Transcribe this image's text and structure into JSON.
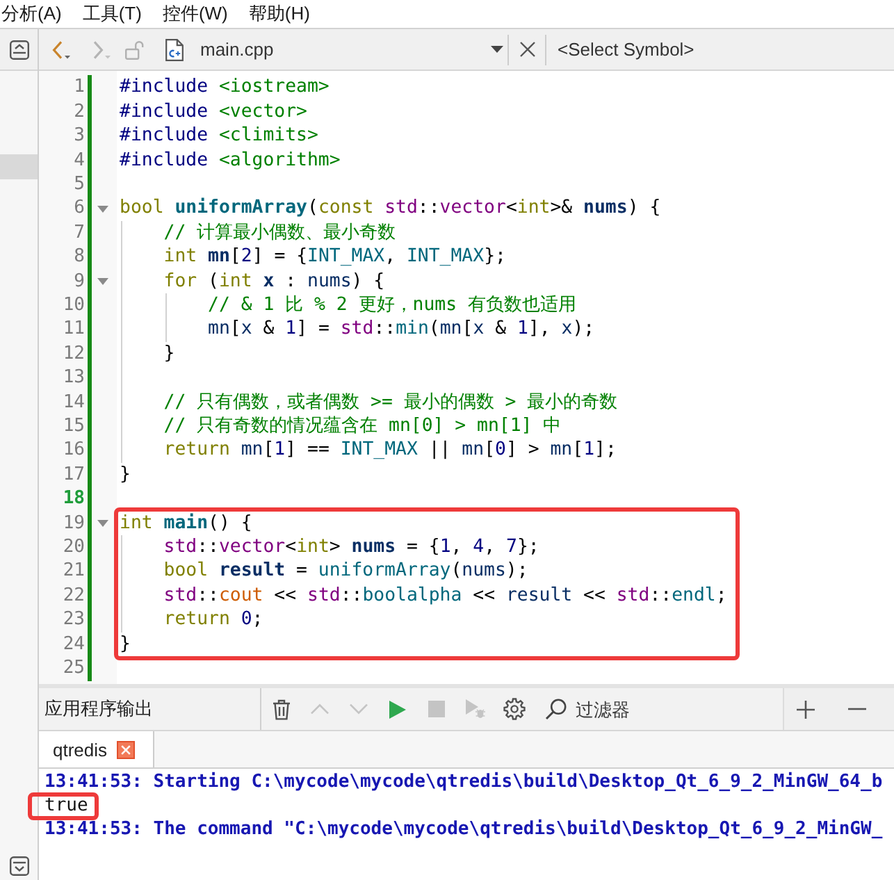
{
  "menu_bar": {
    "items": [
      {
        "label": "分析(A)"
      },
      {
        "label": "工具(T)"
      },
      {
        "label": "控件(W)"
      },
      {
        "label": "帮助(H)"
      }
    ]
  },
  "toolbar": {
    "navigation": [
      {
        "kind": "back",
        "disabled": false
      },
      {
        "kind": "forward",
        "disabled": true
      }
    ],
    "lock": {
      "locked": false
    },
    "file": {
      "name": "main.cpp"
    },
    "symbol": {
      "text": "<Select Symbol>"
    }
  },
  "sidebar": {
    "rows": [
      {
        "selected": false
      },
      {
        "selected": false
      },
      {
        "selected": false
      },
      {
        "selected": true
      }
    ]
  },
  "editor": {
    "modified": true,
    "lines": [
      {
        "number": "1",
        "current": false,
        "foldable": false,
        "boxed": false,
        "tokens": [
          {
            "kind": "preproc",
            "text": "#include"
          },
          {
            "kind": "header",
            "text": " <iostream>"
          }
        ]
      },
      {
        "number": "2",
        "current": false,
        "foldable": false,
        "boxed": false,
        "tokens": [
          {
            "kind": "preproc",
            "text": "#include"
          },
          {
            "kind": "header",
            "text": " <vector>"
          }
        ]
      },
      {
        "number": "3",
        "current": false,
        "foldable": false,
        "boxed": false,
        "tokens": [
          {
            "kind": "preproc",
            "text": "#include"
          },
          {
            "kind": "header",
            "text": " <climits>"
          }
        ]
      },
      {
        "number": "4",
        "current": false,
        "foldable": false,
        "boxed": false,
        "tokens": [
          {
            "kind": "preproc",
            "text": "#include"
          },
          {
            "kind": "header",
            "text": " <algorithm>"
          }
        ]
      },
      {
        "number": "5",
        "current": false,
        "foldable": false,
        "boxed": false
      },
      {
        "number": "6",
        "current": false,
        "foldable": true,
        "boxed": false,
        "tokens": [
          {
            "kind": "keyword",
            "text": "bool"
          },
          {
            "kind": "funcdecl",
            "text": " uniformArray"
          },
          {
            "kind": "punct",
            "text": "("
          },
          {
            "kind": "keyword",
            "text": "const"
          },
          {
            "kind": "namespace",
            "text": " std"
          },
          {
            "kind": "punct",
            "text": "::"
          },
          {
            "kind": "type",
            "text": "vector"
          },
          {
            "kind": "punct",
            "text": "<"
          },
          {
            "kind": "keyword",
            "text": "int"
          },
          {
            "kind": "punct",
            "text": ">& "
          },
          {
            "kind": "decl",
            "text": "nums"
          },
          {
            "kind": "punct",
            "text": ") {"
          }
        ]
      },
      {
        "number": "7",
        "current": false,
        "foldable": false,
        "boxed": false,
        "tokens": [
          {
            "kind": "comment",
            "text": "    // 计算最小偶数、最小奇数"
          }
        ]
      },
      {
        "number": "8",
        "current": false,
        "foldable": false,
        "boxed": false,
        "tokens": [
          {
            "kind": "keyword",
            "text": "    int"
          },
          {
            "kind": "decl",
            "text": " mn"
          },
          {
            "kind": "punct",
            "text": "["
          },
          {
            "kind": "number",
            "text": "2"
          },
          {
            "kind": "punct",
            "text": "] = {"
          },
          {
            "kind": "macro",
            "text": "INT_MAX"
          },
          {
            "kind": "punct",
            "text": ", "
          },
          {
            "kind": "macro",
            "text": "INT_MAX"
          },
          {
            "kind": "punct",
            "text": "};"
          }
        ]
      },
      {
        "number": "9",
        "current": false,
        "foldable": true,
        "boxed": false,
        "tokens": [
          {
            "kind": "keyword",
            "text": "    for"
          },
          {
            "kind": "punct",
            "text": " ("
          },
          {
            "kind": "keyword",
            "text": "int"
          },
          {
            "kind": "decl",
            "text": " x"
          },
          {
            "kind": "punct",
            "text": " : "
          },
          {
            "kind": "var",
            "text": "nums"
          },
          {
            "kind": "punct",
            "text": ") {"
          }
        ]
      },
      {
        "number": "10",
        "current": false,
        "foldable": false,
        "boxed": false,
        "tokens": [
          {
            "kind": "comment",
            "text": "        // & 1 比 % 2 更好，nums 有负数也适用"
          }
        ]
      },
      {
        "number": "11",
        "current": false,
        "foldable": false,
        "boxed": false,
        "tokens": [
          {
            "kind": "var",
            "text": "        mn"
          },
          {
            "kind": "punct",
            "text": "["
          },
          {
            "kind": "var",
            "text": "x"
          },
          {
            "kind": "punct",
            "text": " & "
          },
          {
            "kind": "number",
            "text": "1"
          },
          {
            "kind": "punct",
            "text": "] = "
          },
          {
            "kind": "namespace",
            "text": "std"
          },
          {
            "kind": "punct",
            "text": "::"
          },
          {
            "kind": "func",
            "text": "min"
          },
          {
            "kind": "punct",
            "text": "("
          },
          {
            "kind": "var",
            "text": "mn"
          },
          {
            "kind": "punct",
            "text": "["
          },
          {
            "kind": "var",
            "text": "x"
          },
          {
            "kind": "punct",
            "text": " & "
          },
          {
            "kind": "number",
            "text": "1"
          },
          {
            "kind": "punct",
            "text": "], "
          },
          {
            "kind": "var",
            "text": "x"
          },
          {
            "kind": "punct",
            "text": ");"
          }
        ]
      },
      {
        "number": "12",
        "current": false,
        "foldable": false,
        "boxed": false,
        "tokens": [
          {
            "kind": "punct",
            "text": "    }"
          }
        ]
      },
      {
        "number": "13",
        "current": false,
        "foldable": false,
        "boxed": false
      },
      {
        "number": "14",
        "current": false,
        "foldable": false,
        "boxed": false,
        "tokens": [
          {
            "kind": "comment",
            "text": "    // 只有偶数，或者偶数 >= 最小的偶数 > 最小的奇数"
          }
        ]
      },
      {
        "number": "15",
        "current": false,
        "foldable": false,
        "boxed": false,
        "tokens": [
          {
            "kind": "comment",
            "text": "    // 只有奇数的情况蕴含在 mn[0] > mn[1] 中"
          }
        ]
      },
      {
        "number": "16",
        "current": false,
        "foldable": false,
        "boxed": false,
        "tokens": [
          {
            "kind": "keyword",
            "text": "    return"
          },
          {
            "kind": "var",
            "text": " mn"
          },
          {
            "kind": "punct",
            "text": "["
          },
          {
            "kind": "number",
            "text": "1"
          },
          {
            "kind": "punct",
            "text": "] == "
          },
          {
            "kind": "macro",
            "text": "INT_MAX"
          },
          {
            "kind": "punct",
            "text": " || "
          },
          {
            "kind": "var",
            "text": "mn"
          },
          {
            "kind": "punct",
            "text": "["
          },
          {
            "kind": "number",
            "text": "0"
          },
          {
            "kind": "punct",
            "text": "] > "
          },
          {
            "kind": "var",
            "text": "mn"
          },
          {
            "kind": "punct",
            "text": "["
          },
          {
            "kind": "number",
            "text": "1"
          },
          {
            "kind": "punct",
            "text": "];"
          }
        ]
      },
      {
        "number": "17",
        "current": false,
        "foldable": false,
        "boxed": false,
        "tokens": [
          {
            "kind": "punct",
            "text": "}"
          }
        ]
      },
      {
        "number": "18",
        "current": true,
        "foldable": false,
        "boxed": false
      },
      {
        "number": "19",
        "current": false,
        "foldable": true,
        "boxed": true,
        "tokens": [
          {
            "kind": "keyword",
            "text": "int"
          },
          {
            "kind": "funcdecl",
            "text": " main"
          },
          {
            "kind": "punct",
            "text": "() {"
          }
        ]
      },
      {
        "number": "20",
        "current": false,
        "foldable": false,
        "boxed": true,
        "tokens": [
          {
            "kind": "namespace",
            "text": "    std"
          },
          {
            "kind": "punct",
            "text": "::"
          },
          {
            "kind": "type",
            "text": "vector"
          },
          {
            "kind": "punct",
            "text": "<"
          },
          {
            "kind": "keyword",
            "text": "int"
          },
          {
            "kind": "punct",
            "text": "> "
          },
          {
            "kind": "decl",
            "text": "nums"
          },
          {
            "kind": "punct",
            "text": " = {"
          },
          {
            "kind": "number",
            "text": "1"
          },
          {
            "kind": "punct",
            "text": ", "
          },
          {
            "kind": "number",
            "text": "4"
          },
          {
            "kind": "punct",
            "text": ", "
          },
          {
            "kind": "number",
            "text": "7"
          },
          {
            "kind": "punct",
            "text": "};"
          }
        ]
      },
      {
        "number": "21",
        "current": false,
        "foldable": false,
        "boxed": true,
        "tokens": [
          {
            "kind": "keyword",
            "text": "    bool"
          },
          {
            "kind": "decl",
            "text": " result"
          },
          {
            "kind": "punct",
            "text": " = "
          },
          {
            "kind": "func",
            "text": "uniformArray"
          },
          {
            "kind": "punct",
            "text": "("
          },
          {
            "kind": "var",
            "text": "nums"
          },
          {
            "kind": "punct",
            "text": ");"
          }
        ]
      },
      {
        "number": "22",
        "current": false,
        "foldable": false,
        "boxed": true,
        "tokens": [
          {
            "kind": "namespace",
            "text": "    std"
          },
          {
            "kind": "punct",
            "text": "::"
          },
          {
            "kind": "global",
            "text": "cout"
          },
          {
            "kind": "punct",
            "text": " << "
          },
          {
            "kind": "namespace",
            "text": "std"
          },
          {
            "kind": "punct",
            "text": "::"
          },
          {
            "kind": "func",
            "text": "boolalpha"
          },
          {
            "kind": "punct",
            "text": " << "
          },
          {
            "kind": "var",
            "text": "result"
          },
          {
            "kind": "punct",
            "text": " << "
          },
          {
            "kind": "namespace",
            "text": "std"
          },
          {
            "kind": "punct",
            "text": "::"
          },
          {
            "kind": "func",
            "text": "endl"
          },
          {
            "kind": "punct",
            "text": ";"
          }
        ]
      },
      {
        "number": "23",
        "current": false,
        "foldable": false,
        "boxed": true,
        "tokens": [
          {
            "kind": "keyword",
            "text": "    return"
          },
          {
            "kind": "number",
            "text": " 0"
          },
          {
            "kind": "punct",
            "text": ";"
          }
        ]
      },
      {
        "number": "24",
        "current": false,
        "foldable": false,
        "boxed": true,
        "tokens": [
          {
            "kind": "punct",
            "text": "}"
          }
        ]
      },
      {
        "number": "25",
        "current": false,
        "foldable": false,
        "boxed": false
      }
    ]
  },
  "output_pane": {
    "title": "应用程序输出",
    "buttons": [
      {
        "kind": "clear",
        "disabled": false
      },
      {
        "kind": "previous",
        "disabled": true
      },
      {
        "kind": "next",
        "disabled": true
      },
      {
        "kind": "run",
        "disabled": false
      },
      {
        "kind": "stop",
        "disabled": true
      },
      {
        "kind": "debug",
        "disabled": true
      },
      {
        "kind": "settings",
        "disabled": false
      }
    ],
    "filter": {
      "placeholder": "过滤器"
    },
    "size_buttons": [
      {
        "kind": "zoom_in"
      },
      {
        "kind": "zoom_out"
      }
    ],
    "tabs": [
      {
        "label": "qtredis",
        "selected": true
      }
    ],
    "lines": [
      {
        "kind": "message",
        "text": "13:41:53: Starting C:\\mycode\\mycode\\qtredis\\build\\Desktop_Qt_6_9_2_MinGW_64_b",
        "boxed": false
      },
      {
        "kind": "stdout",
        "text": "true",
        "boxed": true
      },
      {
        "kind": "message",
        "text": "13:41:53: The command \"C:\\mycode\\mycode\\qtredis\\build\\Desktop_Qt_6_9_2_MinGW_",
        "boxed": false
      }
    ]
  }
}
